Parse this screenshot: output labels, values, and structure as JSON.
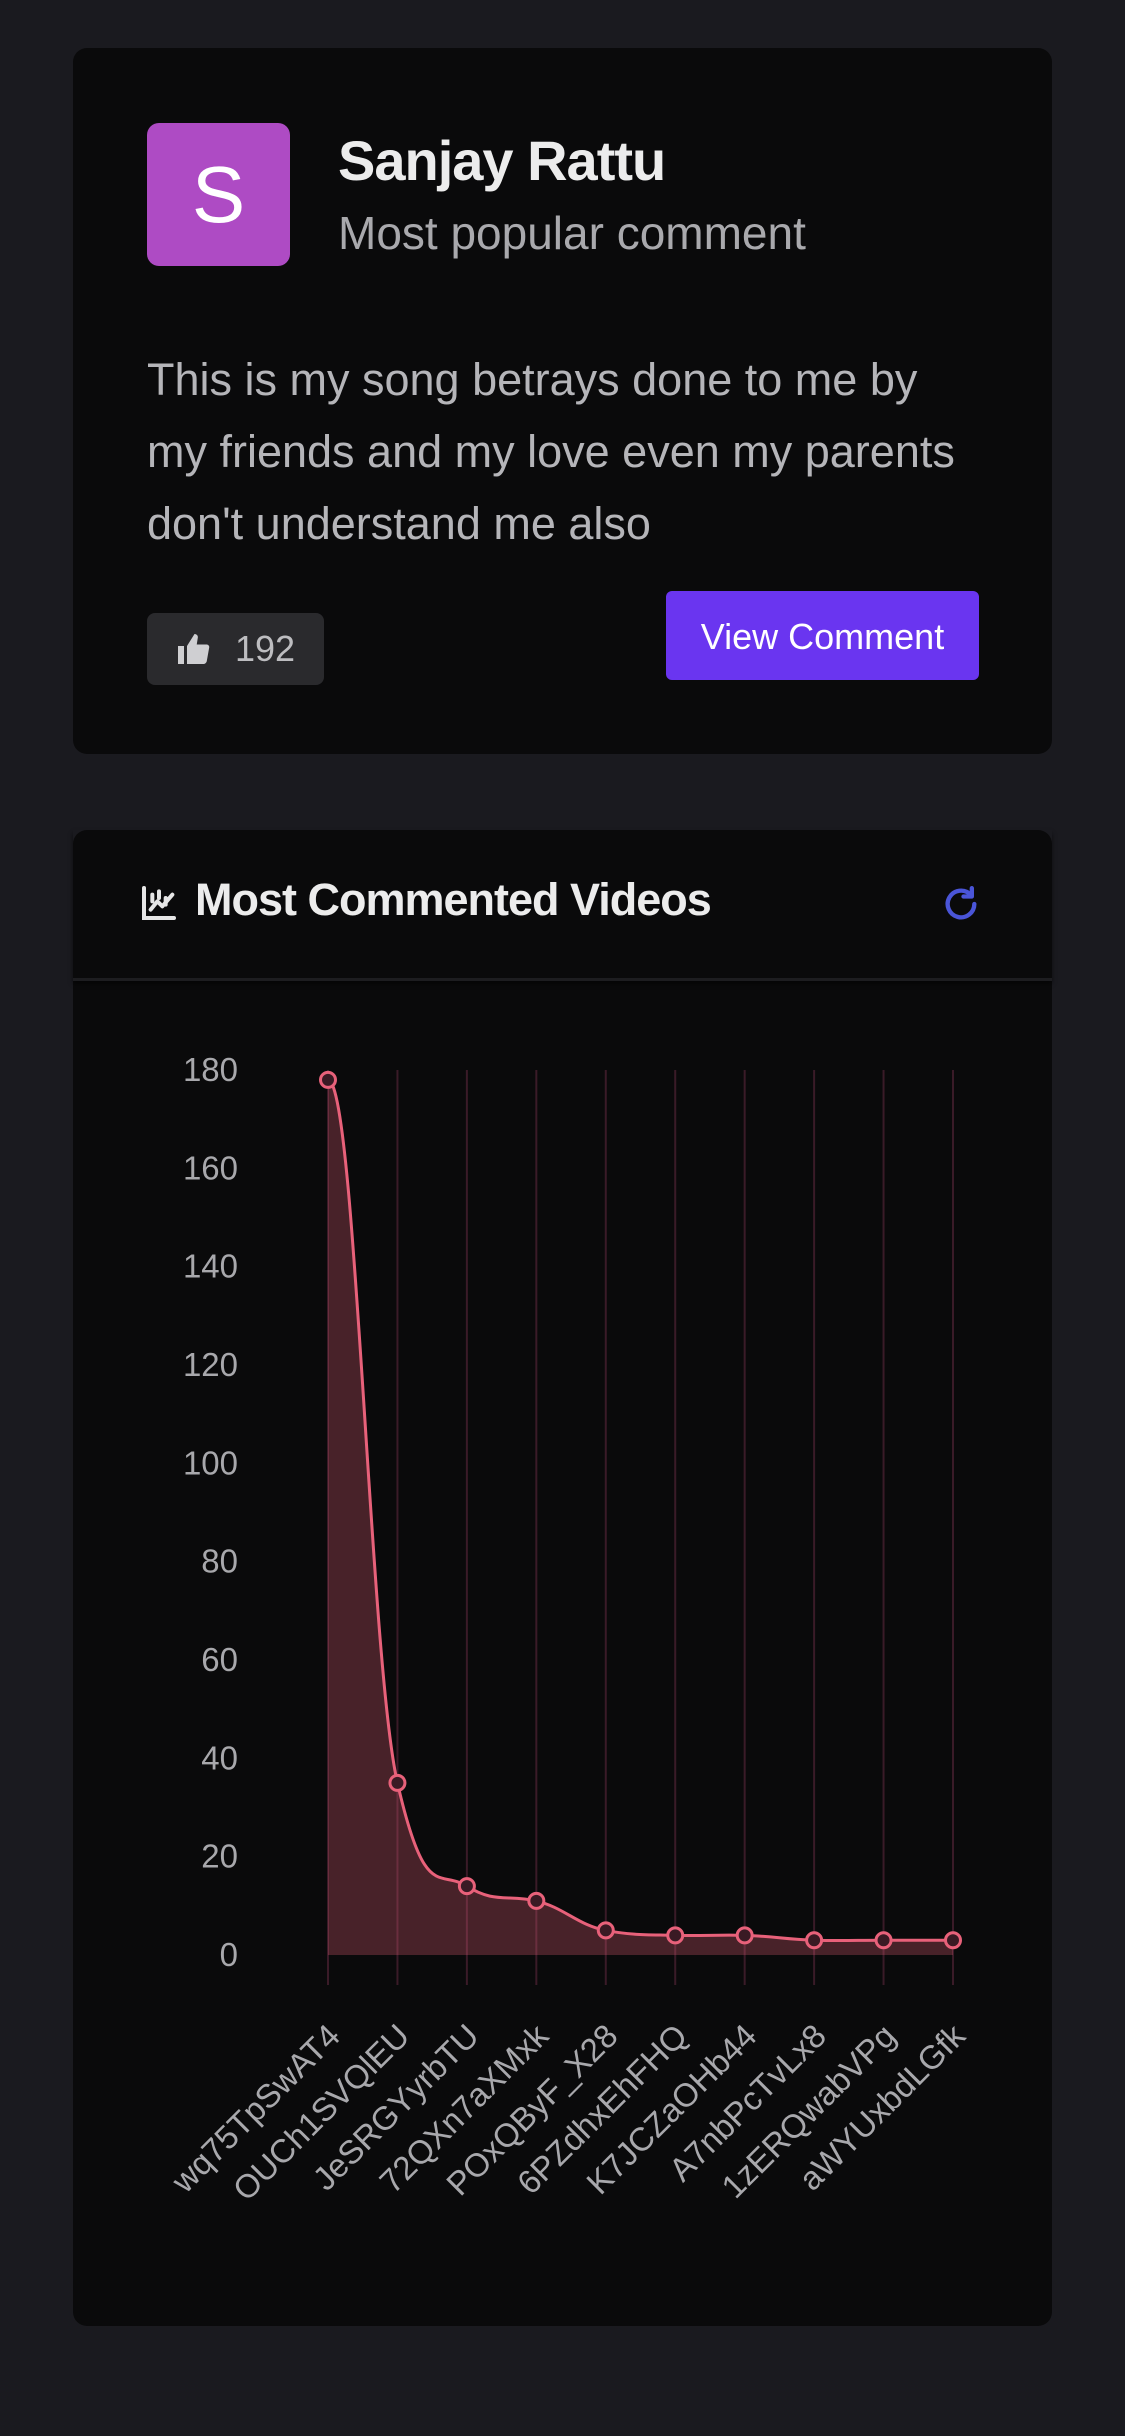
{
  "comment_card": {
    "avatar_letter": "S",
    "avatar_color": "#ae4bc4",
    "author": "Sanjay Rattu",
    "subtitle": "Most popular comment",
    "text": "This is my song betrays done to me by my friends and my love even my parents don't understand me also",
    "likes": "192",
    "like_icon": "thumbs-up-icon",
    "view_button": "View Comment",
    "accent": "#6a35f0"
  },
  "chart_card": {
    "title": "Most Commented Videos",
    "title_icon": "chart-icon",
    "refresh_icon": "refresh-icon"
  },
  "chart_data": {
    "type": "area",
    "title": "Most Commented Videos",
    "xlabel": "",
    "ylabel": "",
    "categories": [
      "wq75TpSwAT4",
      "OUCh1SVQlEU",
      "JeSRGYyrbTU",
      "72QXn7aXMxk",
      "POxQByF_X28",
      "6PZdhxEhFHQ",
      "K7JCZaOHb44",
      "A7nbPcTvLx8",
      "1zERQwabVPg",
      "aWYUxbdLGfk"
    ],
    "series": [
      {
        "values": [
          178,
          35,
          14,
          11,
          5,
          4,
          4,
          3,
          3,
          3
        ],
        "color": "#e8617a"
      }
    ],
    "ylim": [
      0,
      180
    ],
    "yticks": [
      0,
      20,
      40,
      60,
      80,
      100,
      120,
      140,
      160,
      180
    ],
    "grid": "vertical"
  }
}
